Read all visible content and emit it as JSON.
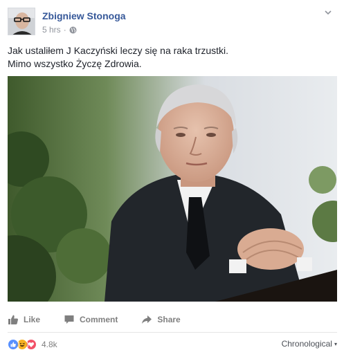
{
  "post": {
    "author": "Zbigniew Stonoga",
    "timestamp": "5 hrs",
    "separator": "·",
    "privacy_icon": "globe-icon",
    "menu_icon": "chevron-down-icon",
    "text_lines": [
      "Jak ustaliłem J Kaczyński leczy się na raka trzustki.",
      "Mimo wszystko Życzę Zdrowia."
    ]
  },
  "actions": {
    "like_label": "Like",
    "comment_label": "Comment",
    "share_label": "Share"
  },
  "reactions": {
    "icons": [
      "like-icon",
      "haha-icon",
      "love-icon"
    ],
    "count": "4.8k"
  },
  "comments_sort": {
    "label": "Chronological",
    "caret": "▾"
  },
  "colors": {
    "author": "#365899",
    "like_blue": "#5890ff",
    "haha_yellow": "#f7b125",
    "love_red": "#f25268",
    "muted": "#90949c"
  }
}
